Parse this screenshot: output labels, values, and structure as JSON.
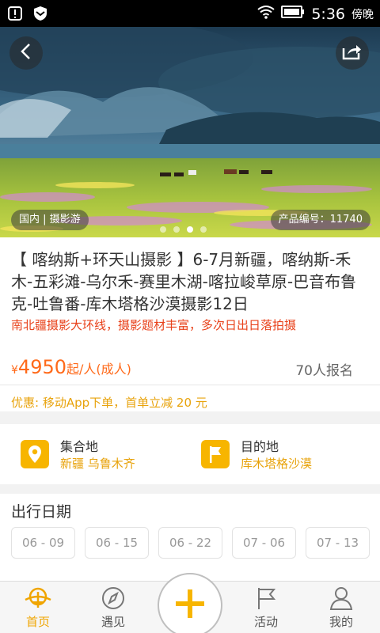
{
  "status_bar": {
    "time": "5:36",
    "period": "傍晚",
    "icons": [
      "notification-icon",
      "shield-icon",
      "wifi-icon",
      "battery-icon"
    ]
  },
  "hero": {
    "category_tag": "国内 | 摄影游",
    "product_code": "产品编号：11740",
    "carousel_total": 4,
    "carousel_active": 3
  },
  "product": {
    "title": "【 喀纳斯+环天山摄影 】6-7月新疆，喀纳斯-禾木-五彩滩-乌尔禾-赛里木湖-喀拉峻草原-巴音布鲁克-吐鲁番-库木塔格沙漠摄影12日",
    "subtitle": "南北疆摄影大环线，摄影题材丰富，多次日出日落拍摄",
    "currency": "¥",
    "price": "4950",
    "price_unit": "起/人(成人)",
    "signups": "70人报名",
    "promo": "优惠: 移动App下单，首单立减 20 元"
  },
  "places": {
    "departure_label": "集合地",
    "departure_value": "新疆 乌鲁木齐",
    "destination_label": "目的地",
    "destination_value": "库木塔格沙漠"
  },
  "dates": {
    "header": "出行日期",
    "options": [
      "06 - 09",
      "06 - 15",
      "06 - 22",
      "07 - 06",
      "07 - 13"
    ]
  },
  "nav": {
    "home": "首页",
    "meet": "遇见",
    "activity": "活动",
    "mine": "我的",
    "active": "home"
  },
  "colors": {
    "accent": "#f7b500",
    "price": "#ff6a1a",
    "subtitle": "#e8421b",
    "promo": "#e8a30c"
  }
}
